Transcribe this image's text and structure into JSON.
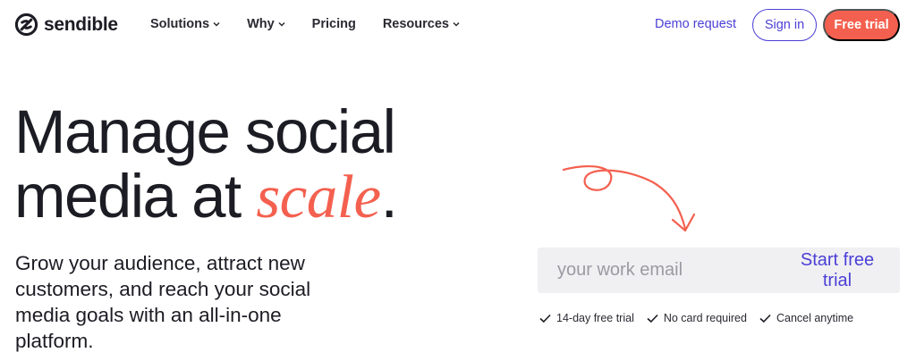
{
  "brand": {
    "name": "sendible"
  },
  "nav": {
    "items": [
      {
        "label": "Solutions",
        "has_dropdown": true
      },
      {
        "label": "Why",
        "has_dropdown": true
      },
      {
        "label": "Pricing",
        "has_dropdown": false
      },
      {
        "label": "Resources",
        "has_dropdown": true
      }
    ],
    "demo_label": "Demo request",
    "signin_label": "Sign in",
    "trial_label": "Free trial"
  },
  "hero": {
    "line1": "Manage social",
    "line2_start": "media at ",
    "accent_word": "scale",
    "line2_end": ".",
    "subtitle": "Grow your audience, attract new customers, and reach your social media goals with an all-in-one platform."
  },
  "signup": {
    "email_placeholder": "your work email",
    "email_value": "",
    "submit_label": "Start free trial"
  },
  "perks": [
    "14-day free trial",
    "No card required",
    "Cancel anytime"
  ],
  "colors": {
    "accent": "#f4604f",
    "brand_purple": "#4b3fd6",
    "text": "#1c1c24",
    "input_bg": "#f0f0f2"
  },
  "icons": {
    "logo": "sendible-logo-icon",
    "dropdown": "chevron-down-icon",
    "arrow": "curly-arrow-icon",
    "perk": "checkmark-icon"
  }
}
